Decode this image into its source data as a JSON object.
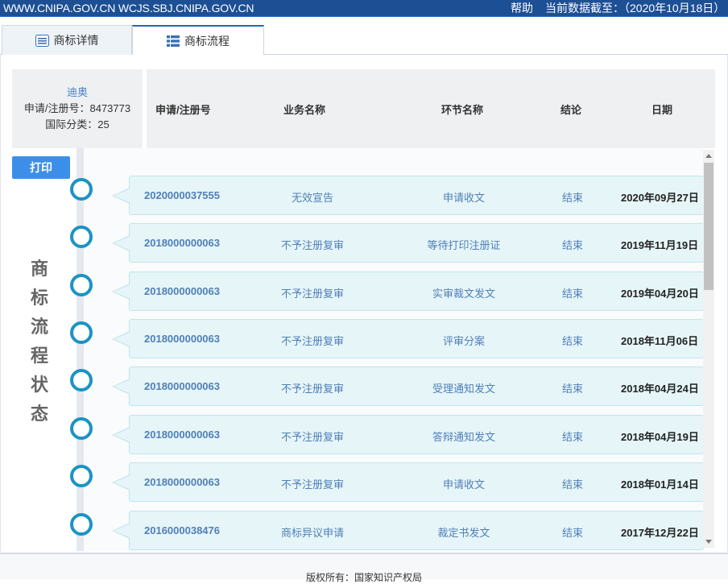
{
  "topbar": {
    "sites": "WWW.CNIPA.GOV.CN WCJS.SBJ.CNIPA.GOV.CN",
    "help": "帮助",
    "as_of": "当前数据截至：（2020年10月18日）"
  },
  "tabs": [
    {
      "label": "商标详情",
      "icon": "detail-icon"
    },
    {
      "label": "商标流程",
      "icon": "list-icon",
      "active": true
    }
  ],
  "info": {
    "name": "迪奥",
    "reg_no": "申请/注册号：8473773",
    "class": "国际分类：25"
  },
  "table_headers": [
    "申请/注册号",
    "业务名称",
    "环节名称",
    "结论",
    "日期"
  ],
  "print_label": "打印",
  "side_title": [
    "商",
    "标",
    "流",
    "程",
    "状",
    "态"
  ],
  "rows": [
    {
      "no": "2020000037555",
      "business": "无效宣告",
      "step": "申请收文",
      "result": "结束",
      "date": "2020年09月27日"
    },
    {
      "no": "2018000000063",
      "business": "不予注册复审",
      "step": "等待打印注册证",
      "result": "结束",
      "date": "2019年11月19日"
    },
    {
      "no": "2018000000063",
      "business": "不予注册复审",
      "step": "实审裁文发文",
      "result": "结束",
      "date": "2019年04月20日"
    },
    {
      "no": "2018000000063",
      "business": "不予注册复审",
      "step": "评审分案",
      "result": "结束",
      "date": "2018年11月06日"
    },
    {
      "no": "2018000000063",
      "business": "不予注册复审",
      "step": "受理通知发文",
      "result": "结束",
      "date": "2018年04月24日"
    },
    {
      "no": "2018000000063",
      "business": "不予注册复审",
      "step": "答辩通知发文",
      "result": "结束",
      "date": "2018年04月19日"
    },
    {
      "no": "2018000000063",
      "business": "不予注册复审",
      "step": "申请收文",
      "result": "结束",
      "date": "2018年01月14日"
    },
    {
      "no": "2016000038476",
      "business": "商标异议申请",
      "step": "裁定书发文",
      "result": "结束",
      "date": "2017年12月22日"
    }
  ],
  "footer": "版权所有：国家知识产权局",
  "colors": {
    "topbar": "#1d4f95",
    "accent": "#3c8fe8",
    "timeline": "#1b93c6",
    "card": "#e6f5f7"
  }
}
